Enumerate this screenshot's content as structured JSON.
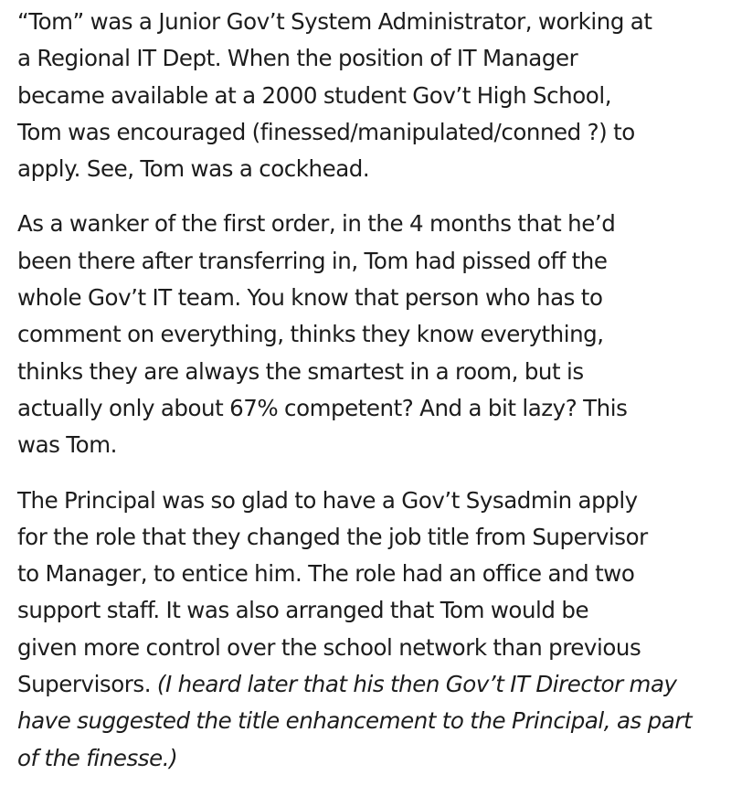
{
  "post": {
    "paragraphs": [
      {
        "lines": [
          "“Tom” was a Junior Gov’t System Administrator, working at",
          "a Regional IT Dept. When the position of IT Manager",
          "became available at a 2000 student Gov’t High School,",
          "Tom was encouraged (finessed/manipulated/conned ?) to",
          "apply. See, Tom was a cockhead."
        ]
      },
      {
        "lines": [
          "As a wanker of the first order, in the 4 months that he’d",
          "been there after transferring in, Tom had pissed off the",
          "whole Gov’t IT team. You know that person who has to",
          "comment on everything, thinks they know everything,",
          "thinks they are always the smartest in a room, but is",
          "actually only about 67% competent? And a bit lazy? This",
          "was Tom."
        ]
      },
      {
        "lines": [
          "The Principal was so glad to have a Gov’t Sysadmin apply",
          "for the role that they changed the job title from Supervisor",
          "to Manager, to entice him. The role had an office and two",
          "support staff. It was also arranged that Tom would be",
          "given more control over the school network than previous"
        ],
        "mixed_line": {
          "plain": "Supervisors. ",
          "italic": "(I heard later that his then Gov’t IT Director may"
        },
        "italic_lines": [
          "have suggested the title enhancement to the Principal, as part",
          "of the finesse.)"
        ]
      }
    ]
  }
}
